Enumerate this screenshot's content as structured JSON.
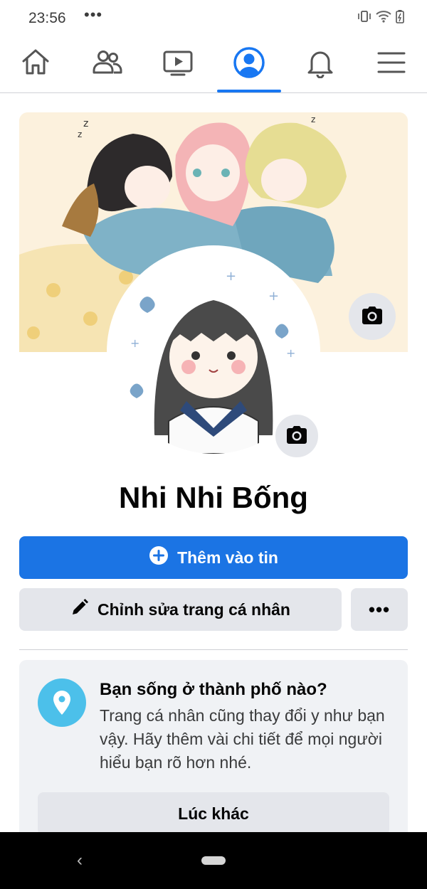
{
  "status_bar": {
    "time": "23:56",
    "dots": "•••",
    "icons": [
      "vibrate-icon",
      "wifi-icon",
      "battery-icon"
    ]
  },
  "navbar": {
    "tabs": [
      {
        "name": "home-icon",
        "active": false
      },
      {
        "name": "friends-icon",
        "active": false
      },
      {
        "name": "watch-icon",
        "active": false
      },
      {
        "name": "profile-icon",
        "active": true
      },
      {
        "name": "bell-icon",
        "active": false
      },
      {
        "name": "menu-icon",
        "active": false
      }
    ],
    "accent": "#1877f2"
  },
  "profile": {
    "name": "Nhi Nhi Bống",
    "cover_icon": "camera-icon",
    "avatar_icon": "camera-icon"
  },
  "actions": {
    "add_story": "Thêm vào tin",
    "add_story_icon": "plus-circle-icon",
    "edit_profile": "Chỉnh sửa trang cá nhân",
    "edit_profile_icon": "pencil-icon",
    "more": "•••"
  },
  "city_card": {
    "icon": "location-pin-icon",
    "title": "Bạn sống ở thành phố nào?",
    "body": "Trang cá nhân cũng thay đổi y như bạn vậy. Hãy thêm vài chi tiết để mọi người hiểu bạn rõ hơn nhé.",
    "button": "Lúc khác"
  },
  "android_nav": {
    "back": "‹"
  },
  "colors": {
    "primary_button": "#1b74e4",
    "secondary_button": "#e4e6eb",
    "card_background": "#f0f2f5",
    "location_icon_bg": "#4cc0ea"
  }
}
